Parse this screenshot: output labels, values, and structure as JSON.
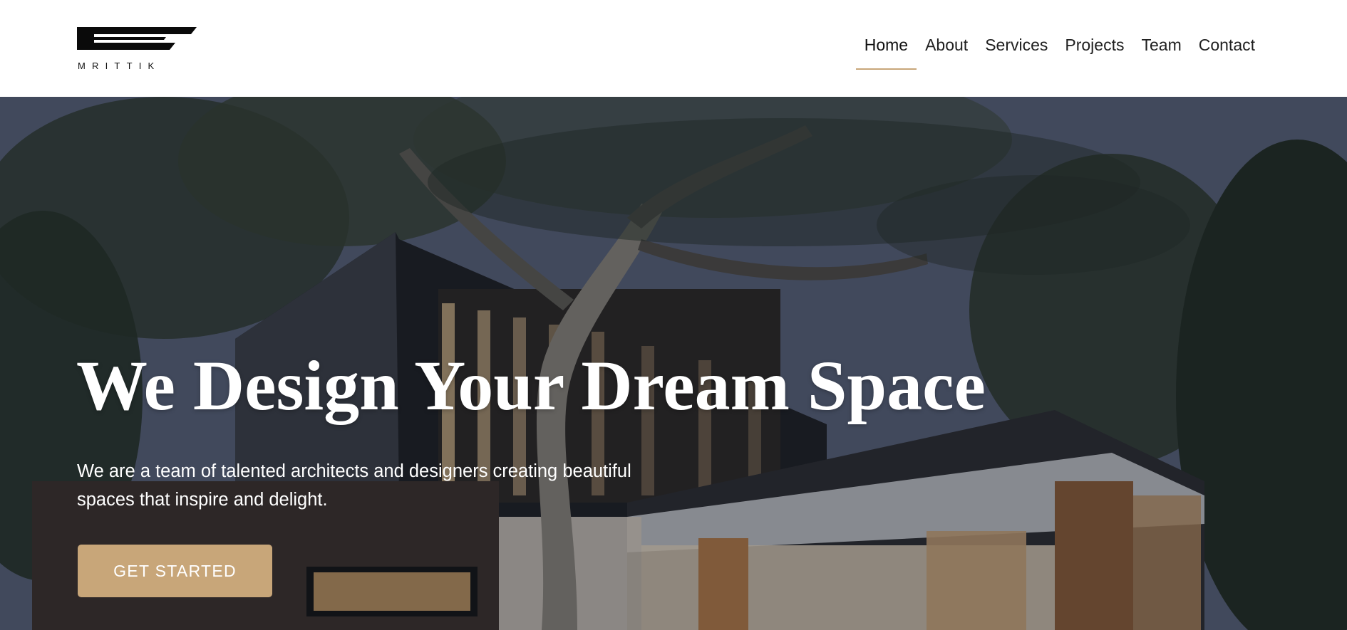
{
  "brand": {
    "name": "MRITTIK",
    "logo_icon": "mrittik-logo-mark"
  },
  "nav": {
    "items": [
      {
        "label": "Home",
        "active": true
      },
      {
        "label": "About",
        "active": false
      },
      {
        "label": "Services",
        "active": false
      },
      {
        "label": "Projects",
        "active": false
      },
      {
        "label": "Team",
        "active": false
      },
      {
        "label": "Contact",
        "active": false
      }
    ]
  },
  "hero": {
    "title": "We Design Your Dream Space",
    "subtitle": "We are a team of talented architects and designers creating beautiful spaces that inspire and delight.",
    "cta_label": "GET STARTED",
    "background_image": "modern-house-with-tree-at-dusk"
  },
  "colors": {
    "accent": "#c8a679",
    "text_dark": "#1f1f1f",
    "header_bg": "#ffffff",
    "hero_text": "#ffffff"
  }
}
